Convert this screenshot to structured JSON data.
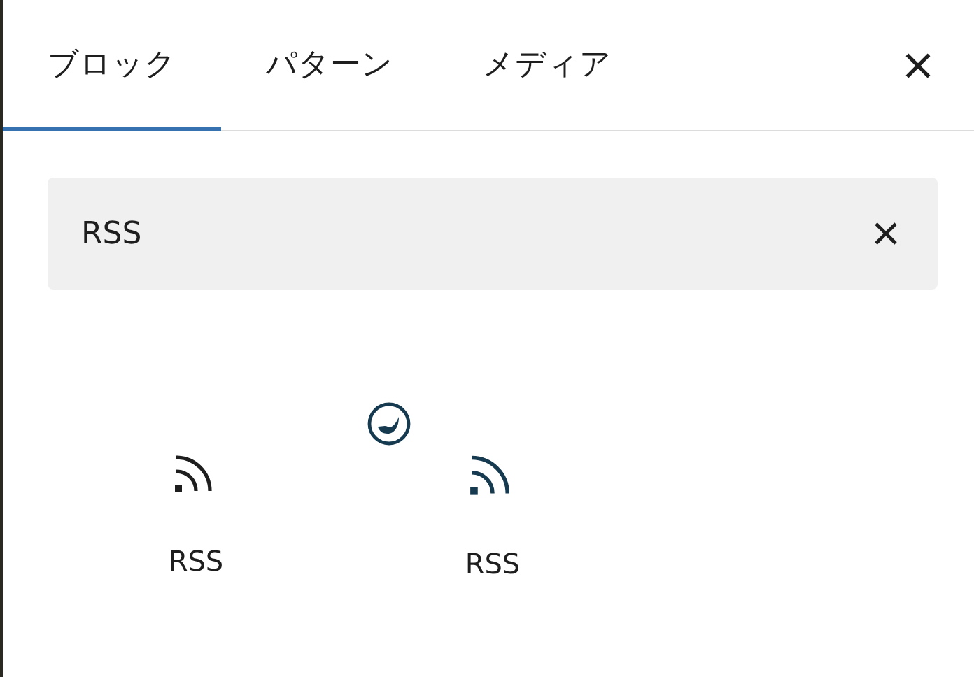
{
  "tabs": [
    {
      "label": "ブロック",
      "selected": true
    },
    {
      "label": "パターン",
      "selected": false
    },
    {
      "label": "メディア",
      "selected": false
    }
  ],
  "search": {
    "value": "RSS"
  },
  "results": [
    {
      "label": "RSS",
      "kind": "core"
    },
    {
      "label": "RSS",
      "kind": "plugin"
    }
  ]
}
